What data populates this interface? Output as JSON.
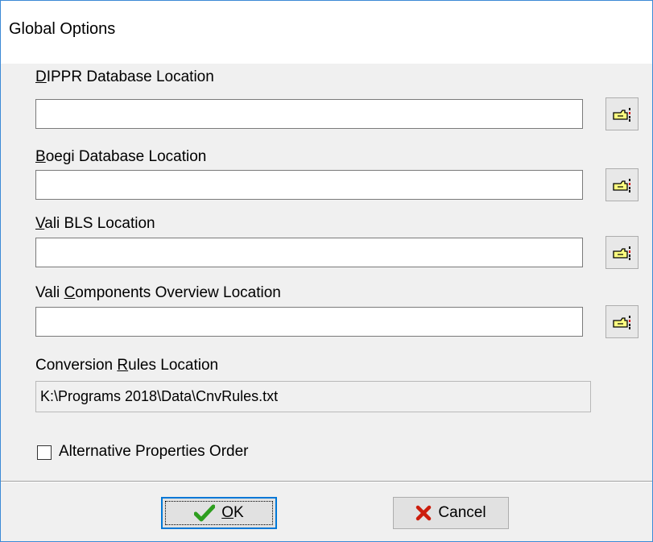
{
  "dialog": {
    "title": "Global Options"
  },
  "fields": [
    {
      "label_pre": "",
      "label_accel": "D",
      "label_post": "IPPR Database Location",
      "value": ""
    },
    {
      "label_pre": "",
      "label_accel": "B",
      "label_post": "oegi Database Location",
      "value": ""
    },
    {
      "label_pre": "",
      "label_accel": "V",
      "label_post": "ali BLS Location",
      "value": ""
    },
    {
      "label_pre": "Vali ",
      "label_accel": "C",
      "label_post": "omponents Overview Location",
      "value": ""
    }
  ],
  "conversion": {
    "label_pre": "Conversion ",
    "label_accel": "R",
    "label_post": "ules Location",
    "value": "K:\\Programs 2018\\Data\\CnvRules.txt"
  },
  "checkbox": {
    "label": "Alternative Properties Order",
    "checked": false
  },
  "buttons": {
    "ok": {
      "accel": "O",
      "rest": "K"
    },
    "cancel": {
      "label": "Cancel"
    }
  },
  "icons": {
    "browse": "pointing-hand-folder-icon",
    "ok": "checkmark-icon",
    "cancel": "x-icon"
  },
  "colors": {
    "accent": "#0078d7",
    "ok_check": "#2e9e1f",
    "cancel_x": "#cc1d0d"
  }
}
